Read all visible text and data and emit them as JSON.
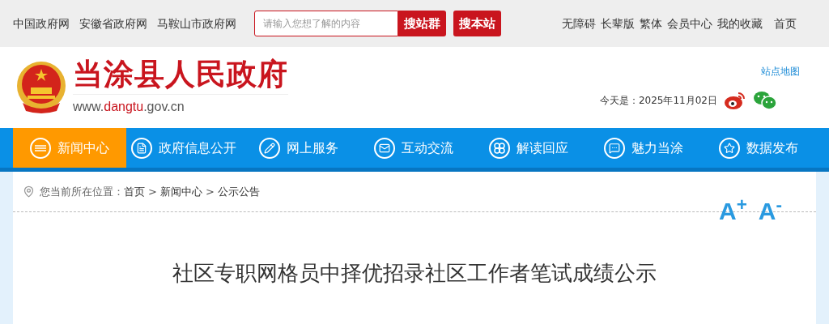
{
  "top_bar": {
    "links": [
      "中国政府网",
      "安徽省政府网",
      "马鞍山市政府网"
    ],
    "search": {
      "placeholder": "请输入您想了解的内容",
      "buttons": [
        "搜站群",
        "搜本站"
      ]
    },
    "right_links": [
      "无障碍",
      "长辈版",
      "繁体",
      "会员中心",
      "我的收藏",
      "首页"
    ]
  },
  "header": {
    "site_name": "当涂县人民政府",
    "url_parts": [
      "www.",
      "dangtu",
      ".gov.cn"
    ],
    "sitemap": "站点地图",
    "date": "今天是：2025年11月02日"
  },
  "nav": [
    {
      "label": "新闻中心",
      "selected": true,
      "kind": "news"
    },
    {
      "label": "政府信息公开",
      "selected": false,
      "kind": "document"
    },
    {
      "label": "网上服务",
      "selected": false,
      "kind": "pencil"
    },
    {
      "label": "互动交流",
      "selected": false,
      "kind": "mail"
    },
    {
      "label": "解读回应",
      "selected": false,
      "kind": "clover"
    },
    {
      "label": "魅力当涂",
      "selected": false,
      "kind": "chat"
    },
    {
      "label": "数据发布",
      "selected": false,
      "kind": "star"
    }
  ],
  "breadcrumb": {
    "label": "您当前所在位置：",
    "items": [
      {
        "text": "首页",
        "kind": "link"
      },
      {
        "text": ">",
        "kind": "sep"
      },
      {
        "text": "新闻中心",
        "kind": "link"
      },
      {
        "text": ">",
        "kind": "sep"
      },
      {
        "text": "公示公告",
        "kind": "link"
      }
    ]
  },
  "font_size_buttons": [
    "A$^{+}$",
    "A$^{-}$"
  ],
  "article": {
    "title": "社区专职网格员中择优招录社区工作者笔试成绩公示"
  }
}
